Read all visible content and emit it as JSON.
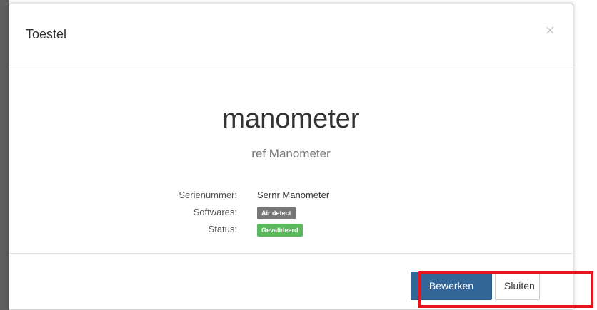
{
  "modal": {
    "title": "Toestel",
    "close_glyph": "×"
  },
  "device": {
    "name": "manometer",
    "reference": "ref Manometer"
  },
  "details": {
    "serial_label": "Serienummer:",
    "serial_value": "Sernr Manometer",
    "softwares_label": "Softwares:",
    "softwares_badge": "Air detect",
    "status_label": "Status:",
    "status_badge": "Gevalideerd"
  },
  "footer": {
    "edit_label": "Bewerken",
    "close_label": "Sluiten"
  },
  "colors": {
    "primary": "#336699",
    "success": "#5cb85c",
    "badge_gray": "#777777",
    "annotation_red": "#e8141b"
  },
  "icons": {
    "close": "close-icon"
  }
}
